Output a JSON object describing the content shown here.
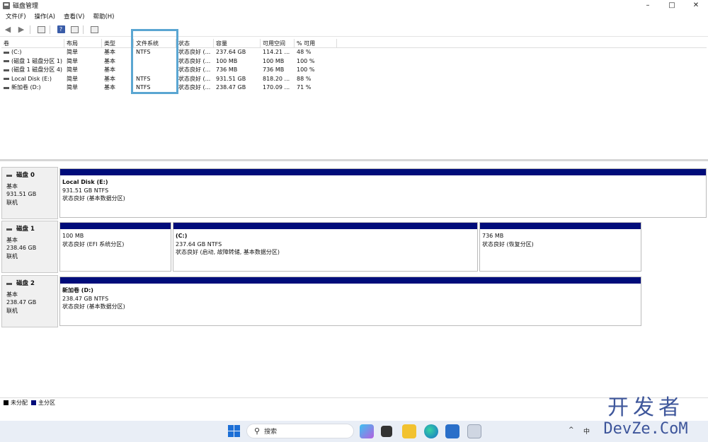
{
  "window": {
    "title": "磁盘管理",
    "controls": [
      "–",
      "□",
      "✕"
    ]
  },
  "menu": [
    "文件(F)",
    "操作(A)",
    "查看(V)",
    "帮助(H)"
  ],
  "volume_table": {
    "headers": [
      "卷",
      "布局",
      "类型",
      "文件系统",
      "状态",
      "容量",
      "可用空间",
      "% 可用"
    ],
    "rows": [
      [
        "(C:)",
        "简单",
        "基本",
        "NTFS",
        "状态良好 (...",
        "237.64 GB",
        "114.21 ...",
        "48 %"
      ],
      [
        "(磁盘 1 磁盘分区 1)",
        "简单",
        "基本",
        "",
        "状态良好 (...",
        "100 MB",
        "100 MB",
        "100 %"
      ],
      [
        "(磁盘 1 磁盘分区 4)",
        "简单",
        "基本",
        "",
        "状态良好 (...",
        "736 MB",
        "736 MB",
        "100 %"
      ],
      [
        "Local Disk (E:)",
        "简单",
        "基本",
        "NTFS",
        "状态良好 (...",
        "931.51 GB",
        "818.20 ...",
        "88 %"
      ],
      [
        "新加卷 (D:)",
        "简单",
        "基本",
        "NTFS",
        "状态良好 (...",
        "238.47 GB",
        "170.09 ...",
        "71 %"
      ]
    ]
  },
  "disks": [
    {
      "name": "磁盘 0",
      "type": "基本",
      "size": "931.51 GB",
      "status": "联机",
      "partitions": [
        {
          "title": "Local Disk  (E:)",
          "size": "931.51 GB NTFS",
          "status": "状态良好 (基本数据分区)"
        }
      ]
    },
    {
      "name": "磁盘 1",
      "type": "基本",
      "size": "238.46 GB",
      "status": "联机",
      "partitions": [
        {
          "title": "",
          "size": "100 MB",
          "status": "状态良好 (EFI 系统分区)"
        },
        {
          "title": "(C:)",
          "size": "237.64 GB NTFS",
          "status": "状态良好 (启动, 故障转储, 基本数据分区)"
        },
        {
          "title": "",
          "size": "736 MB",
          "status": "状态良好 (恢复分区)"
        }
      ]
    },
    {
      "name": "磁盘 2",
      "type": "基本",
      "size": "238.47 GB",
      "status": "联机",
      "partitions": [
        {
          "title": "新加卷  (D:)",
          "size": "238.47 GB NTFS",
          "status": "状态良好 (基本数据分区)"
        }
      ]
    }
  ],
  "legend": [
    {
      "label": "未分配",
      "color": "#000000"
    },
    {
      "label": "主分区",
      "color": "#000c7a"
    }
  ],
  "taskbar": {
    "search_label": "搜索",
    "tray": {
      "chevron": "^",
      "ime": "中"
    }
  },
  "watermark": {
    "line1": "开发者",
    "line2": "DevZe.CoM"
  },
  "colors": {
    "partition_bar": "#000c7a",
    "highlight": "#5aa6d2",
    "taskbar": "#e9eef6"
  }
}
